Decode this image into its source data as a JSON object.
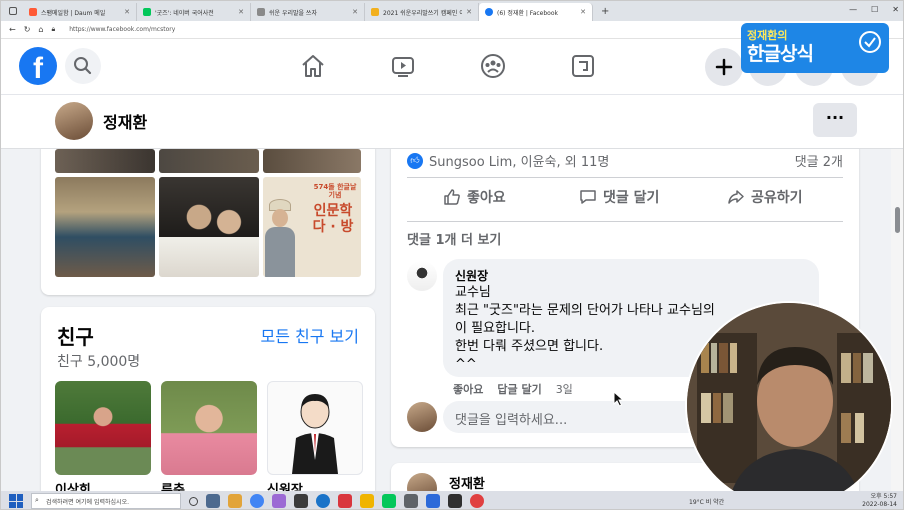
{
  "browser": {
    "tabs": [
      {
        "title": "스팸메일함 | Daum 메일",
        "color": "#ff5a36"
      },
      {
        "title": "'굿즈': 네이버 국어사전",
        "color": "#03c75a"
      },
      {
        "title": "쉬운 우리말을 쓰자",
        "color": "#8a8a8a"
      },
      {
        "title": "2021 쉬운우리말쓰기 캠페인 이!",
        "color": "#f2b01e"
      },
      {
        "title": "(6) 정재환 | Facebook",
        "color": "#1877f2"
      }
    ],
    "new_tab": "+",
    "url": "https://www.facebook.com/mcstory"
  },
  "brand_overlay": {
    "subtitle": "정재환의",
    "title": "한글상식"
  },
  "profile": {
    "name": "정재환",
    "more_label": "···"
  },
  "photo_card": {
    "book_cover_title": "인문학\n다 · 방",
    "book_cover_sub": "574돌 한글날 기념"
  },
  "friends": {
    "title": "친구",
    "count": "친구 5,000명",
    "see_all": "모든 친구 보기",
    "names": [
      "이상희",
      "류춘",
      "신원장"
    ]
  },
  "post": {
    "reactions": "Sungsoo Lim, 이윤숙, 외 11명",
    "comment_count": "댓글 2개",
    "actions": {
      "like": "좋아요",
      "comment": "댓글 달기",
      "share": "공유하기"
    },
    "more_comments": "댓글 1개 더 보기",
    "comment": {
      "author": "신원장",
      "lines": [
        "교수님",
        "최근 \"굿즈\"라는 문제의 단어가 나타나 교수님의",
        "이 필요합니다.",
        "한번 다뤄 주셨으면 합니다.",
        "^^"
      ],
      "like": "좋아요",
      "reply": "답글 달기",
      "time": "3일"
    },
    "input_placeholder": "댓글을 입력하세요...",
    "next_post_author": "정재환"
  },
  "taskbar": {
    "search_placeholder": "검색하려면 여기에 입력하십시오.",
    "weather": "19°C 비 약간",
    "time": "오후 5:57",
    "date": "2022-08-14"
  }
}
